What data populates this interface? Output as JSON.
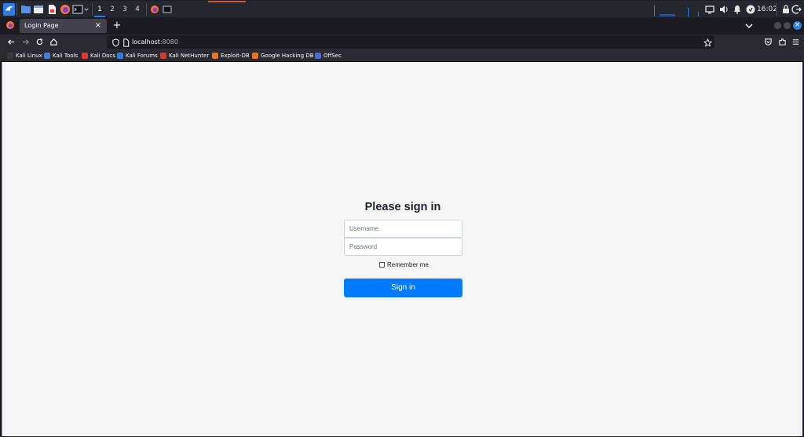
{
  "panel": {
    "workspaces": [
      "1",
      "2",
      "3",
      "4"
    ],
    "active_workspace": "1",
    "clock": "16:02",
    "icons": [
      "kali-menu-icon",
      "file-manager-icon",
      "terminal-icon",
      "text-editor-icon",
      "firefox-icon",
      "root-terminal-icon",
      "window-firefox-icon",
      "window-terminal-icon",
      "display-icon",
      "volume-icon",
      "notifications-icon",
      "updates-icon",
      "lock-icon",
      "logout-icon"
    ],
    "accent_color": "#e0522c"
  },
  "browser": {
    "tab": {
      "title": "Login Page",
      "close": "×"
    },
    "new_tab": "+",
    "url": {
      "host": "localhost",
      "port": ":8080"
    },
    "bookmarks": [
      {
        "label": "Kali Linux",
        "color": "#3a3a3a"
      },
      {
        "label": "Kali Tools",
        "color": "#4b7bd6"
      },
      {
        "label": "Kali Docs",
        "color": "#e23a3a"
      },
      {
        "label": "Kali Forums",
        "color": "#3a7ad8"
      },
      {
        "label": "Kali NetHunter",
        "color": "#d23a3a"
      },
      {
        "label": "Exploit-DB",
        "color": "#e8742a"
      },
      {
        "label": "Google Hacking DB",
        "color": "#e8742a"
      },
      {
        "label": "OffSec",
        "color": "#4b6bd6"
      }
    ],
    "window_close": "×"
  },
  "page": {
    "heading": "Please sign in",
    "username_placeholder": "Username",
    "password_placeholder": "Password",
    "remember_label": "Remember me",
    "signin_label": "Sign in",
    "primary_color": "#007bff"
  }
}
